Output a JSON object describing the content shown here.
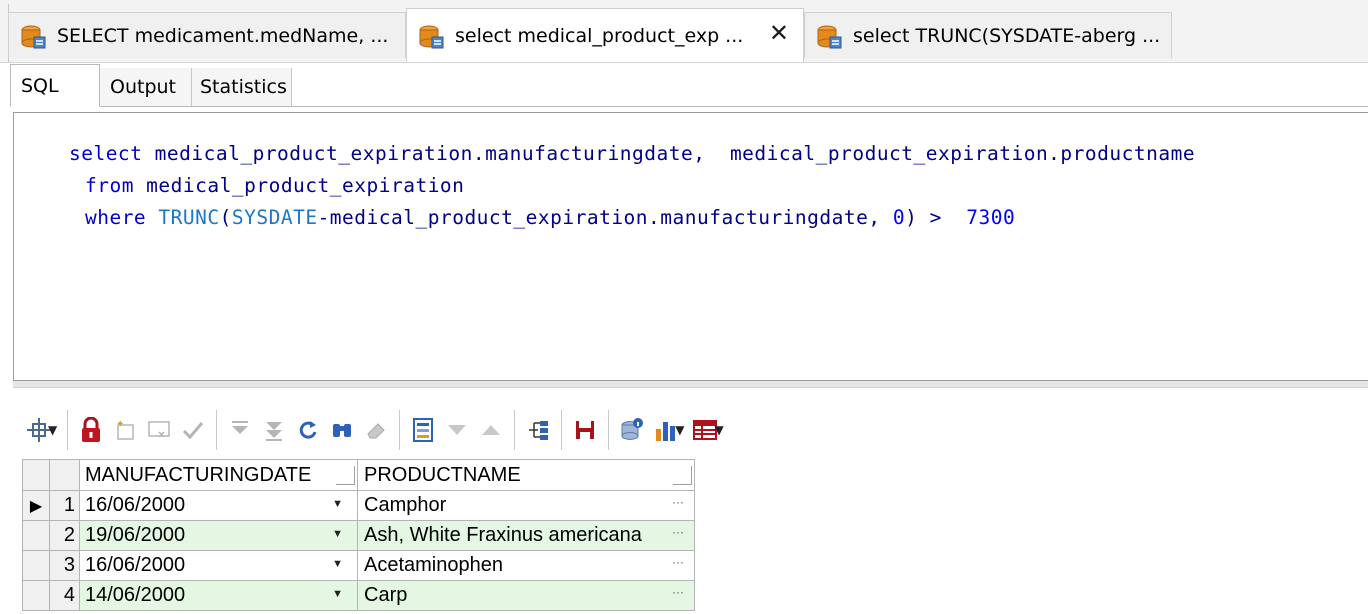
{
  "doc_tabs": [
    {
      "label": "SELECT medicament.medName, ...",
      "active": false
    },
    {
      "label": "select medical_product_exp ...",
      "active": true
    },
    {
      "label": "select TRUNC(SYSDATE-aberg ...",
      "active": false
    }
  ],
  "close_glyph": "✕",
  "sub_tabs": [
    "SQL",
    "Output",
    "Statistics"
  ],
  "sql": {
    "line1": {
      "kw": "select",
      "rest": " medical_product_expiration.manufacturingdate,  medical_product_expiration.productname"
    },
    "line2": {
      "kw": "from",
      "rest": " medical_product_expiration"
    },
    "line3": {
      "kw": "where",
      "fn": "TRUNC",
      "mid1": "(",
      "fn2": "SYSDATE",
      "mid2": "-medical_product_expiration.manufacturingdate, ",
      "num0": "0",
      "mid3": ") >  ",
      "num": "7300"
    }
  },
  "grid": {
    "columns": [
      "MANUFACTURINGDATE",
      "PRODUCTNAME"
    ],
    "rows": [
      {
        "n": "1",
        "date": "16/06/2000",
        "product": "Camphor"
      },
      {
        "n": "2",
        "date": "19/06/2000",
        "product": "Ash, White Fraxinus americana"
      },
      {
        "n": "3",
        "date": "16/06/2000",
        "product": "Acetaminophen"
      },
      {
        "n": "4",
        "date": "14/06/2000",
        "product": "Carp"
      }
    ]
  },
  "colors": {
    "accent_orange": "#e38a1d",
    "row_alt": "#e3f7e3",
    "keyword": "#0000cd",
    "sql_text": "#00008b"
  }
}
